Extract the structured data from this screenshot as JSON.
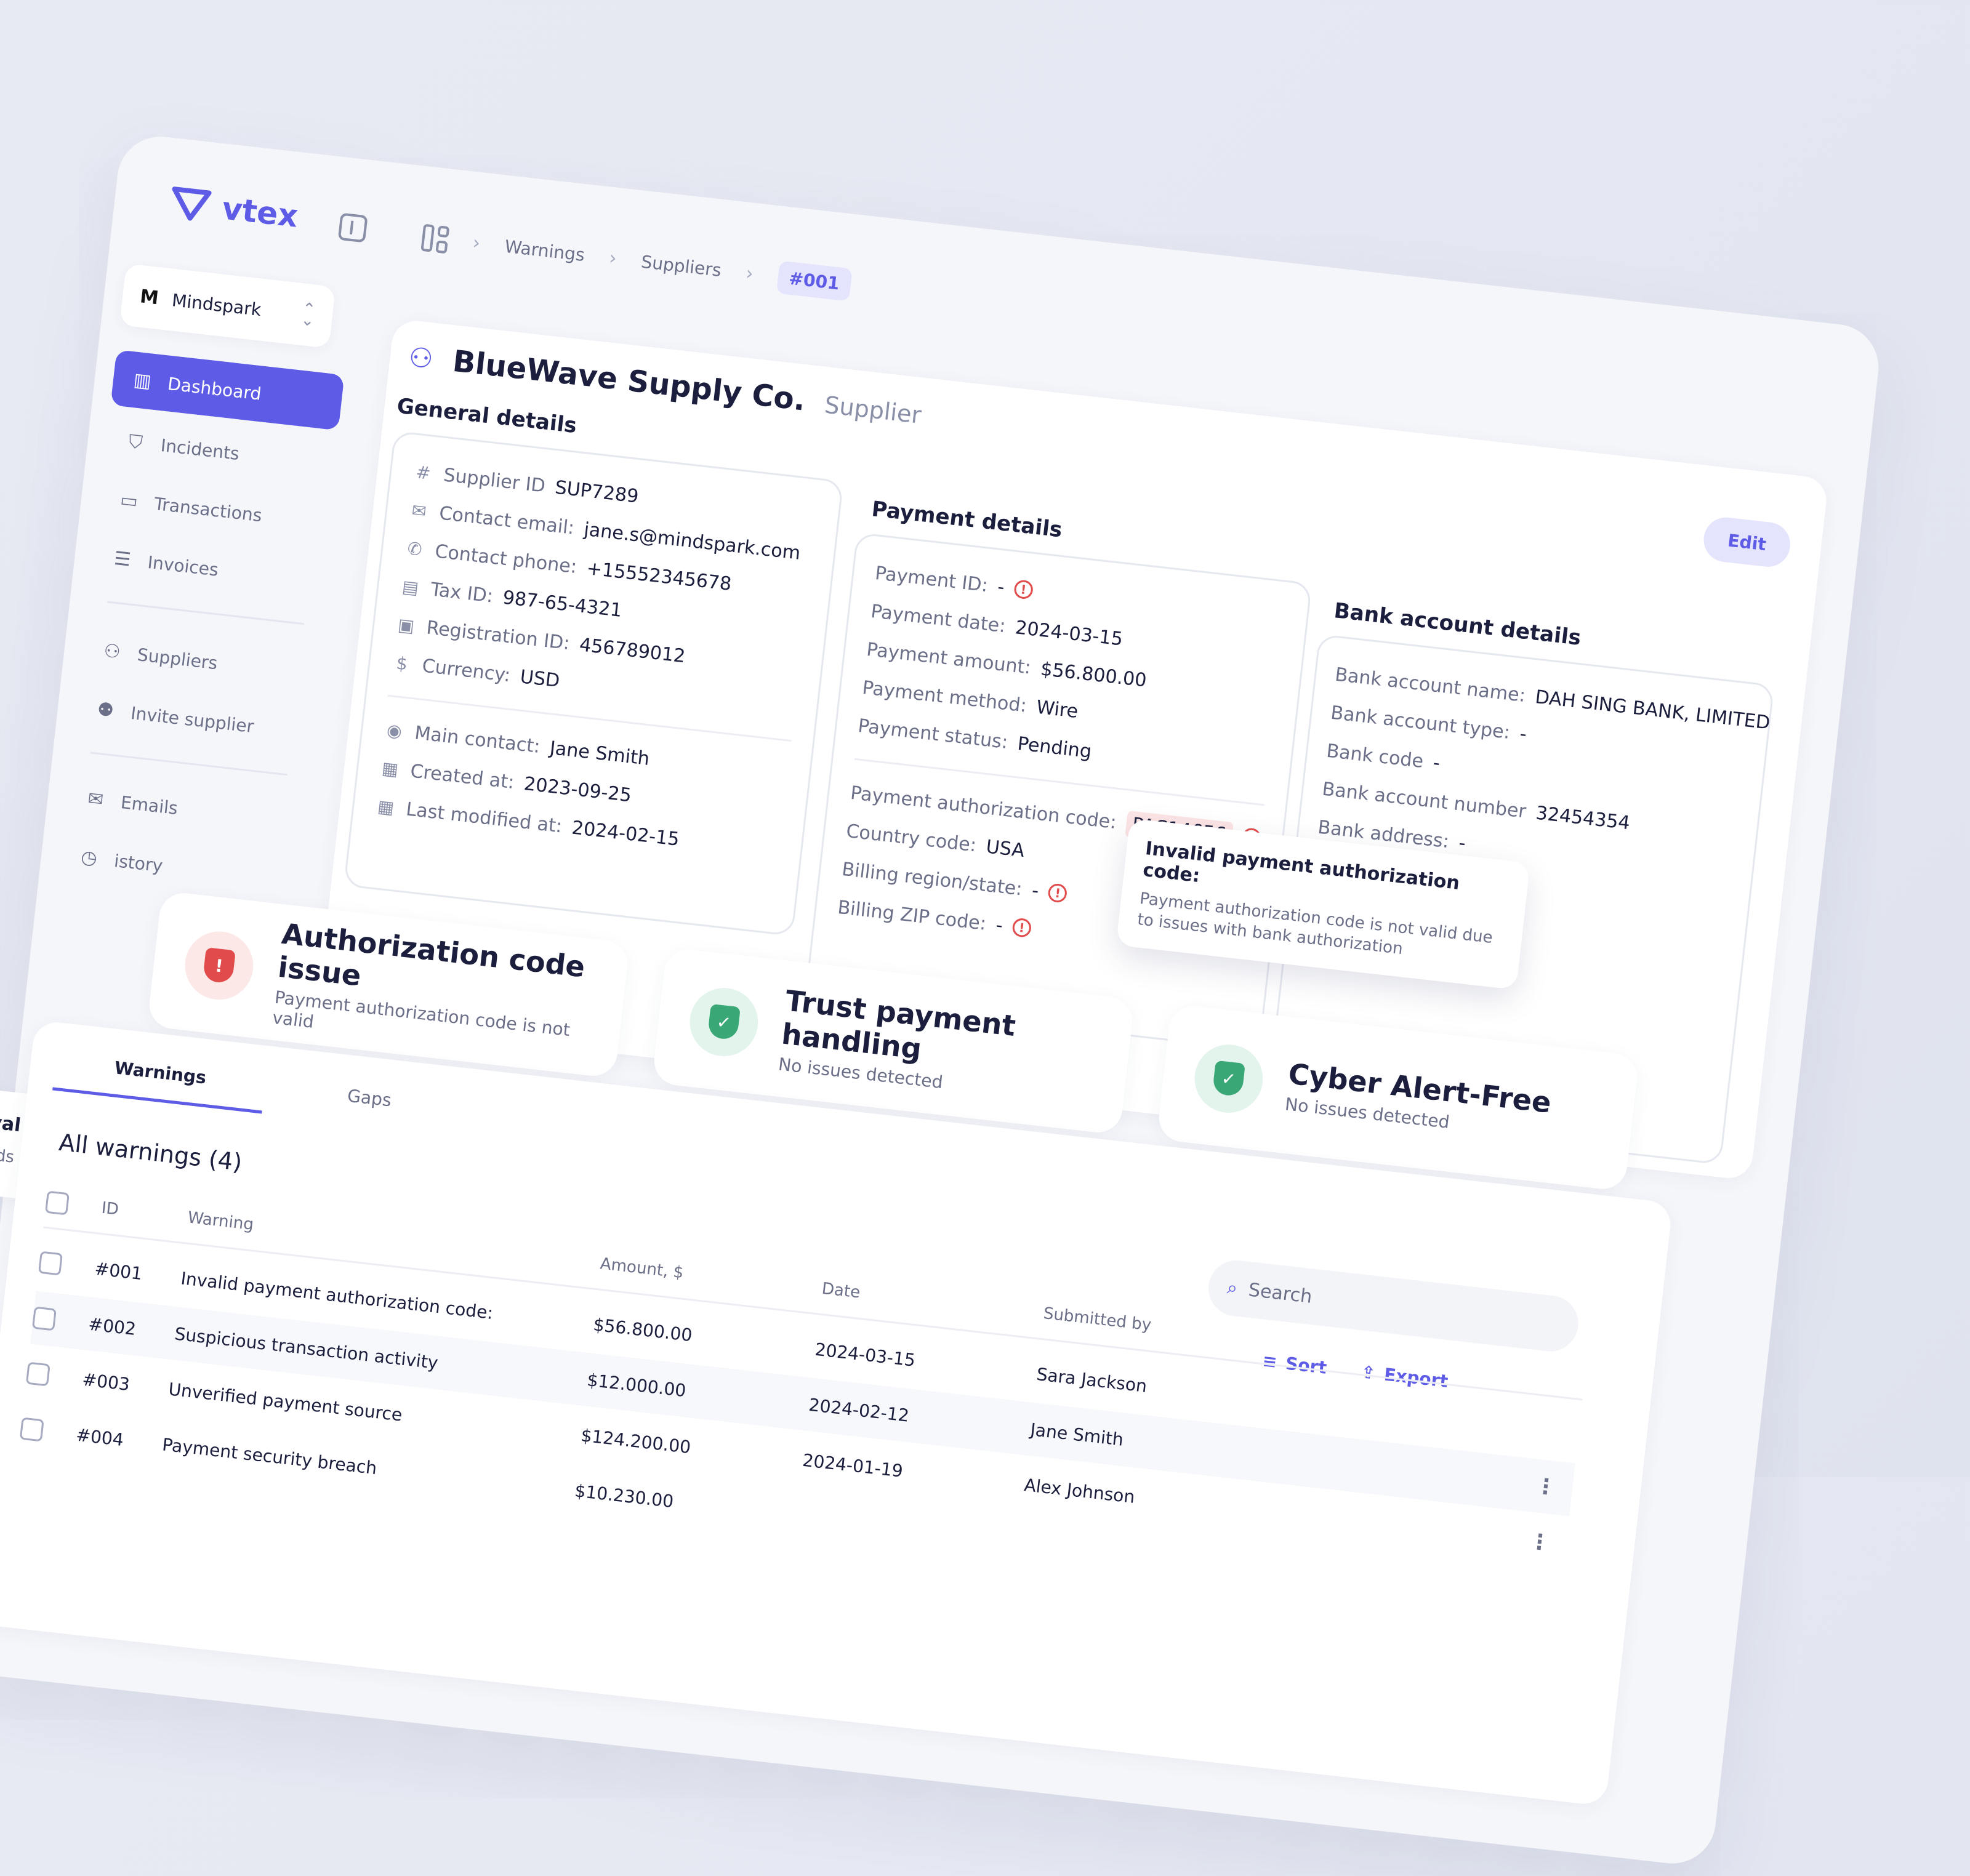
{
  "app": {
    "brand": "vtex",
    "org_name": "Mindspark"
  },
  "breadcrumb": [
    "Warnings",
    "Suppliers",
    "#001"
  ],
  "sidebar": {
    "items": [
      {
        "label": "Dashboard",
        "icon": "dashboard-icon",
        "active": true
      },
      {
        "label": "Incidents",
        "icon": "shield-alert-icon"
      },
      {
        "label": "Transactions",
        "icon": "card-icon"
      },
      {
        "label": "Invoices",
        "icon": "document-icon"
      },
      {
        "label": "Suppliers",
        "icon": "users-icon"
      },
      {
        "label": "Invite supplier",
        "icon": "user-plus-icon"
      },
      {
        "label": "Emails",
        "icon": "mail-icon"
      },
      {
        "label": "istory",
        "icon": "history-icon"
      }
    ],
    "card": {
      "title": "rieval",
      "subtitle": "t funds"
    }
  },
  "supplier": {
    "name": "BlueWave Supply Co.",
    "type": "Supplier",
    "edit_label": "Edit"
  },
  "general": {
    "title": "General details",
    "fields": [
      {
        "label": "Supplier ID",
        "value": "SUP7289"
      },
      {
        "label": "Contact email:",
        "value": "jane.s@mindspark.com"
      },
      {
        "label": "Contact phone:",
        "value": "+15552345678"
      },
      {
        "label": "Tax ID:",
        "value": "987-65-4321"
      },
      {
        "label": "Registration ID:",
        "value": "456789012"
      },
      {
        "label": "Currency:",
        "value": "USD"
      }
    ],
    "meta": [
      {
        "label": "Main contact:",
        "value": "Jane Smith"
      },
      {
        "label": "Created at:",
        "value": "2023-09-25"
      },
      {
        "label": "Last modified at:",
        "value": "2024-02-15"
      }
    ]
  },
  "payment": {
    "title": "Payment details",
    "fields": [
      {
        "label": "Payment ID:",
        "value": "-"
      },
      {
        "label": "Payment date:",
        "value": "2024-03-15"
      },
      {
        "label": "Payment amount:",
        "value": "$56.800.00"
      },
      {
        "label": "Payment method:",
        "value": "Wire"
      },
      {
        "label": "Payment status:",
        "value": "Pending"
      }
    ],
    "auth": [
      {
        "label": "Payment authorization code:",
        "value": "PAC14656"
      },
      {
        "label": "Country code:",
        "value": "USA"
      },
      {
        "label": "Billing region/state:",
        "value": "-"
      },
      {
        "label": "Billing ZIP code:",
        "value": "-"
      }
    ]
  },
  "tooltip": {
    "title": "Invalid payment authorization code:",
    "body": "Payment authorization code is not valid due to issues with bank authorization"
  },
  "bank": {
    "title": "Bank account details",
    "fields": [
      {
        "label": "Bank account name:",
        "value": "DAH SING BANK, LIMITED"
      },
      {
        "label": "Bank account type:",
        "value": "-"
      },
      {
        "label": "Bank code",
        "value": "-"
      },
      {
        "label": "Bank account number",
        "value": "32454354"
      },
      {
        "label": "Bank address:",
        "value": "-"
      }
    ]
  },
  "stats": [
    {
      "title": "Authorization code issue",
      "subtitle": "Payment authorization code is not valid",
      "status": "error"
    },
    {
      "title": "Trust payment handling",
      "subtitle": "No issues detected",
      "status": "ok"
    },
    {
      "title": "Cyber Alert-Free",
      "subtitle": "No issues detected",
      "status": "ok"
    }
  ],
  "table": {
    "tabs": [
      "Warnings",
      "Gaps"
    ],
    "title": "All warnings (4)",
    "search_placeholder": "Search",
    "sort_label": "Sort",
    "export_label": "Export",
    "columns": [
      "ID",
      "Warning",
      "Amount, $",
      "Date",
      "Submitted by"
    ],
    "rows": [
      {
        "id": "#001",
        "warning": "Invalid payment authorization code:",
        "amount": "$56.800.00",
        "date": "2024-03-15",
        "by": "Sara Jackson"
      },
      {
        "id": "#002",
        "warning": "Suspicious transaction activity",
        "amount": "$12.000.00",
        "date": "2024-02-12",
        "by": "Jane Smith"
      },
      {
        "id": "#003",
        "warning": "Unverified payment source",
        "amount": "$124.200.00",
        "date": "2024-01-19",
        "by": "Alex Johnson"
      },
      {
        "id": "#004",
        "warning": "Payment security breach",
        "amount": "$10.230.00",
        "date": "",
        "by": ""
      }
    ]
  },
  "colors": {
    "accent": "#5e5ce6",
    "error": "#e24b4b",
    "success": "#3aa776"
  }
}
